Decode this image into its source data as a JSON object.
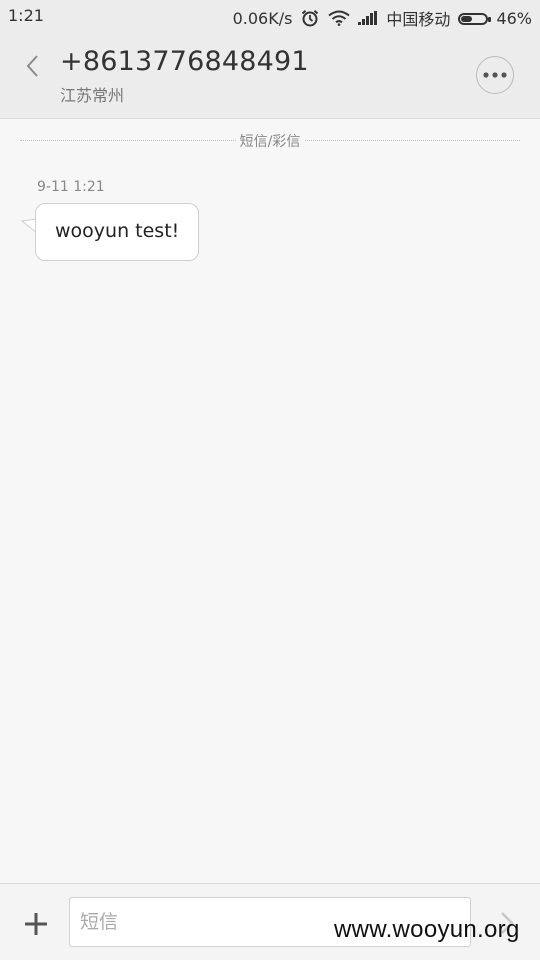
{
  "status_bar": {
    "time": "1:21",
    "network_speed": "0.06K/s",
    "carrier": "中国移动",
    "battery_percent": "46%",
    "battery_level": 0.46,
    "icons": [
      "alarm-icon",
      "wifi-icon",
      "signal-icon",
      "battery-icon"
    ]
  },
  "header": {
    "contact_number": "+8613776848491",
    "contact_location": "江苏常州",
    "icons": [
      "back-arrow-icon",
      "more-options-icon"
    ]
  },
  "conversation": {
    "divider_label": "短信/彩信",
    "messages": [
      {
        "time": "9-11 1:21",
        "text": "wooyun test!",
        "direction": "incoming"
      }
    ]
  },
  "composer": {
    "placeholder": "短信",
    "value": "",
    "icons": [
      "add-icon",
      "send-arrow-icon"
    ]
  },
  "watermark": "www.wooyun.org",
  "colors": {
    "header_bg": "#ececec",
    "page_bg": "#f7f7f7",
    "bubble_bg": "#ffffff"
  }
}
